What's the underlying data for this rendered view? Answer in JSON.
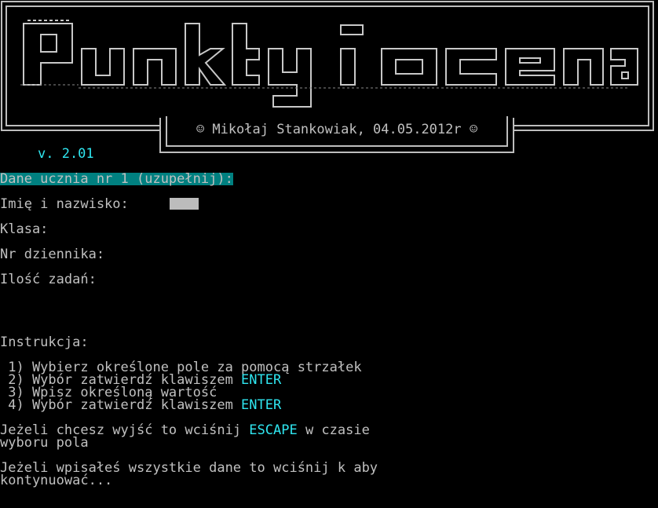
{
  "banner": {
    "logo_text": "Punkty i ocena",
    "author_line": "☺ Mikołaj Stankowiak, 04.05.2012r ☺"
  },
  "version": "v. 2.01",
  "form": {
    "header": "Dane ucznia nr 1 (uzupełnij):",
    "fields": [
      {
        "label": "Imię i nazwisko:",
        "value": ""
      },
      {
        "label": "Klasa:",
        "value": ""
      },
      {
        "label": "Nr dziennika:",
        "value": ""
      },
      {
        "label": "Ilość zadań:",
        "value": ""
      }
    ]
  },
  "instructions": {
    "title": "Instrukcja:",
    "steps": [
      {
        "text": " 1) Wybierz określone pole za pomocą strzałek",
        "key": ""
      },
      {
        "text": " 2) Wybór zatwierdź klawiszem ",
        "key": "ENTER"
      },
      {
        "text": " 3) Wpisz określoną wartość",
        "key": ""
      },
      {
        "text": " 4) Wybór zatwierdź klawiszem ",
        "key": "ENTER"
      }
    ],
    "escape_line1_pre": "Jeżeli chcesz wyjść to wciśnij ",
    "escape_key": "ESCAPE",
    "escape_line1_post": " w czasie",
    "escape_line2": "wyboru pola",
    "continue_line1": "Jeżeli wpisałeś wszystkie dane to wciśnij k aby",
    "continue_line2": "kontynuować..."
  },
  "colors": {
    "background": "#000000",
    "text": "#c0c0c0",
    "accent": "#2fe6f0",
    "header_bg": "#008080",
    "input_bg": "#bcbcbc"
  }
}
